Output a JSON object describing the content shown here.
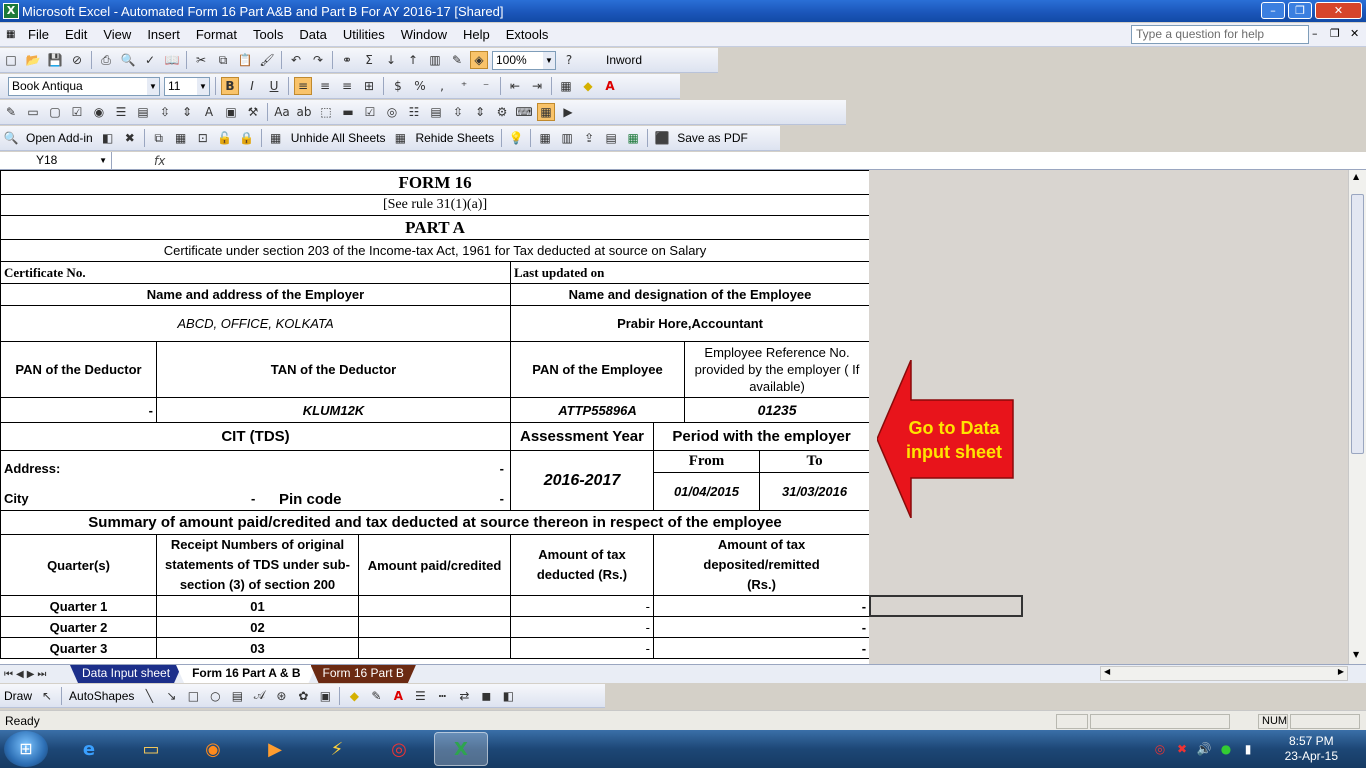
{
  "window": {
    "title": "Microsoft Excel - Automated Form 16 Part A&B and Part B For AY 2016-17  [Shared]"
  },
  "menu": [
    "File",
    "Edit",
    "View",
    "Insert",
    "Format",
    "Tools",
    "Data",
    "Utilities",
    "Window",
    "Help",
    "Extools"
  ],
  "help_placeholder": "Type a question for help",
  "toolbar": {
    "zoom": "100%",
    "inword": "Inword",
    "font": "Book Antiqua",
    "size": "11",
    "open_addin": "Open Add-in",
    "unhide": "Unhide All Sheets",
    "rehide": "Rehide Sheets",
    "save_pdf": "Save as PDF"
  },
  "formula": {
    "name_box": "Y18",
    "fx": "fx"
  },
  "form": {
    "title": "FORM 16",
    "rule": "[See rule 31(1)(a)]",
    "part": "PART A",
    "certificate_line": "Certificate under section 203 of the Income-tax Act, 1961 for Tax deducted at source on Salary",
    "cert_no": "Certificate No.",
    "last_updated": "Last updated on",
    "employer_hdr": "Name and address of the Employer",
    "employee_hdr": "Name and designation of the Employee",
    "employer_val": "ABCD, OFFICE, KOLKATA",
    "employee_val": "Prabir Hore,Accountant",
    "pan_deductor": "PAN of the Deductor",
    "tan_deductor": "TAN of the Deductor",
    "pan_employee": "PAN of the Employee",
    "emp_ref": "Employee Reference No. provided by the employer ( If available)",
    "pan_deductor_val": "-",
    "tan_val": "KLUM12K",
    "pan_emp_val": "ATTP55896A",
    "emp_ref_val": "01235",
    "cit": "CIT (TDS)",
    "ay_hdr": "Assessment Year",
    "period_hdr": "Period with the employer",
    "address": "Address:",
    "address_val": "-",
    "city": "City",
    "city_val": "-",
    "pin": "Pin code",
    "pin_val": "-",
    "ay_val": "2016-2017",
    "from_hdr": "From",
    "to_hdr": "To",
    "from_val": "01/04/2015",
    "to_val": "31/03/2016",
    "summary": "Summary of amount paid/credited and tax deducted at source thereon in respect of the employee",
    "col_quarter": "Quarter(s)",
    "col_receipt": "Receipt Numbers of original statements of TDS under sub-section (3) of section 200",
    "col_paid": "Amount paid/credited",
    "col_tax_deducted": "Amount of tax deducted (Rs.)",
    "col_tax_deposited": "Amount of tax deposited/remitted (Rs.)",
    "quarters": [
      {
        "q": "Quarter 1",
        "r": "01",
        "d": "-",
        "e": "-"
      },
      {
        "q": "Quarter 2",
        "r": "02",
        "d": "-",
        "e": "-"
      },
      {
        "q": "Quarter 3",
        "r": "03",
        "d": "-",
        "e": "-"
      }
    ]
  },
  "arrow_text": "Go to Data input sheet",
  "tabs": [
    "Data Input sheet",
    "Form 16 Part A & B",
    "Form 16 Part B"
  ],
  "draw": {
    "draw": "Draw",
    "autoshapes": "AutoShapes"
  },
  "status": {
    "ready": "Ready",
    "num": "NUM"
  },
  "clock": {
    "time": "8:57 PM",
    "date": "23-Apr-15"
  },
  "colors": {
    "accent": "#1a55b8",
    "arrow": "#e8141b",
    "arrow_text": "#ffe400",
    "tab_active": "#ffffff",
    "tab_data": "#1c2f8a",
    "tab_partb": "#6b2a12"
  }
}
